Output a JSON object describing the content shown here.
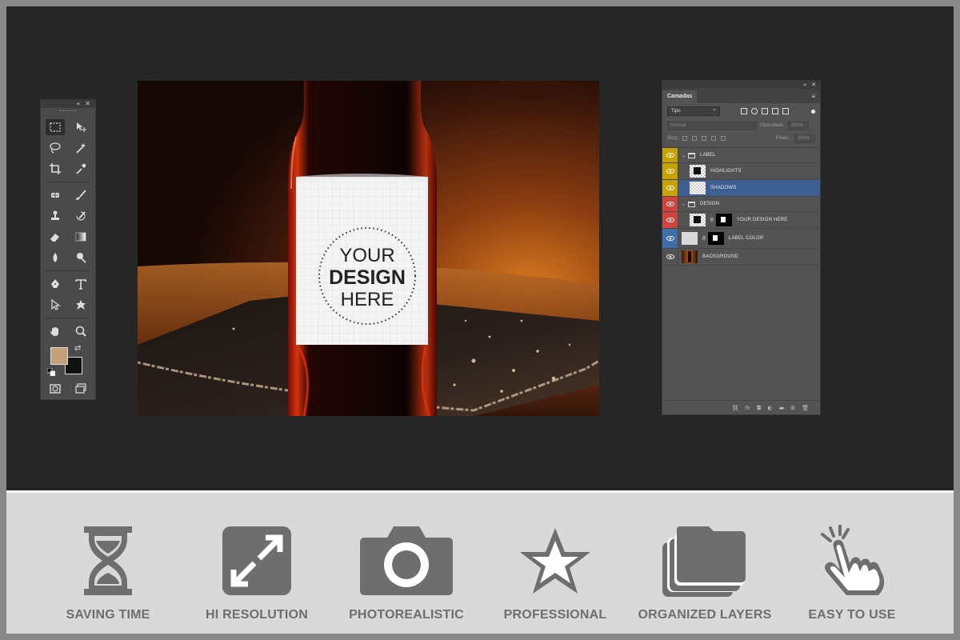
{
  "toolbox": {
    "collapse_icon": "double-chevron-icon",
    "close_icon": "close-icon",
    "foreground_color": "#c4a07a",
    "background_color": "#111111"
  },
  "canvas": {
    "label_line1": "YOUR",
    "label_line2": "DESIGN",
    "label_line3": "HERE"
  },
  "layers_panel": {
    "tab": "Camadas",
    "filter": "Tipo",
    "blend_mode": "Normal",
    "opacity_label": "Opacidade:",
    "opacity_value": "100%",
    "lock_label": "Bloq.:",
    "fill_label": "Preen.:",
    "fill_value": "100%",
    "layers": [
      {
        "name": "LABEL",
        "type": "group",
        "color": "#c8a200"
      },
      {
        "name": "HIGHLIGHTS",
        "type": "layer",
        "color": "#c8a200"
      },
      {
        "name": "SHADOWS",
        "type": "layer",
        "color": "#c8a200",
        "selected": true
      },
      {
        "name": "DESIGN",
        "type": "group",
        "color": "#d0443e"
      },
      {
        "name": "YOUR DESIGN HERE",
        "type": "smart",
        "color": "#d0443e"
      },
      {
        "name": "LABEL COLOR",
        "type": "fill",
        "color": "#3f6fa8"
      },
      {
        "name": "BACKGROUND",
        "type": "image",
        "color": "#535353"
      }
    ]
  },
  "features": [
    {
      "label": "SAVING TIME",
      "icon": "hourglass-icon"
    },
    {
      "label": "HI RESOLUTION",
      "icon": "expand-icon"
    },
    {
      "label": "PHOTOREALISTIC",
      "icon": "camera-icon"
    },
    {
      "label": "PROFESSIONAL",
      "icon": "star-icon"
    },
    {
      "label": "ORGANIZED LAYERS",
      "icon": "layers-icon"
    },
    {
      "label": "EASY TO USE",
      "icon": "hand-click-icon"
    }
  ],
  "colors": {
    "accent_yellow": "#c8a200",
    "accent_red": "#d0443e",
    "accent_blue": "#3f6fa8",
    "selected_layer": "#3e5f92",
    "feature_icon": "#6e6e6e"
  }
}
